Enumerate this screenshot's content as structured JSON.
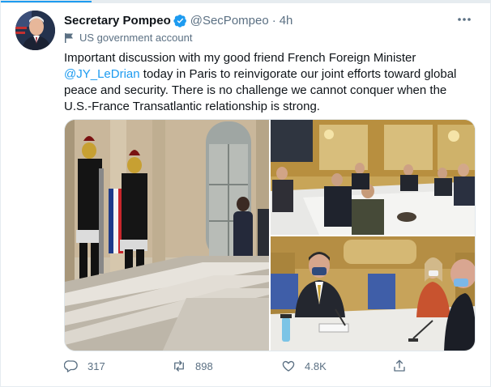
{
  "tweet": {
    "display_name": "Secretary Pompeo",
    "handle": "@SecPompeo",
    "separator": "·",
    "time": "4h",
    "account_label": "US government account",
    "text_before": "Important discussion with my good friend French Foreign Minister ",
    "mention": "@JY_LeDrian",
    "text_after": " today in Paris to reinvigorate our joint efforts toward global peace and security. There is no challenge we cannot conquer when the U.S.-France Transatlantic relationship is strong.",
    "media": [
      {
        "icon": "photo-guards-staircase"
      },
      {
        "icon": "photo-meeting-hall"
      },
      {
        "icon": "photo-pompeo-at-table"
      }
    ]
  },
  "actions": {
    "replies": "317",
    "retweets": "898",
    "likes": "4.8K"
  },
  "colors": {
    "accent": "#1d9bf0",
    "text": "#0f1419",
    "muted": "#5b7083",
    "border": "#e6ecf0"
  },
  "icons": [
    "verified-badge-icon",
    "more-options-icon",
    "flag-icon",
    "reply-icon",
    "retweet-icon",
    "like-icon",
    "share-icon"
  ]
}
